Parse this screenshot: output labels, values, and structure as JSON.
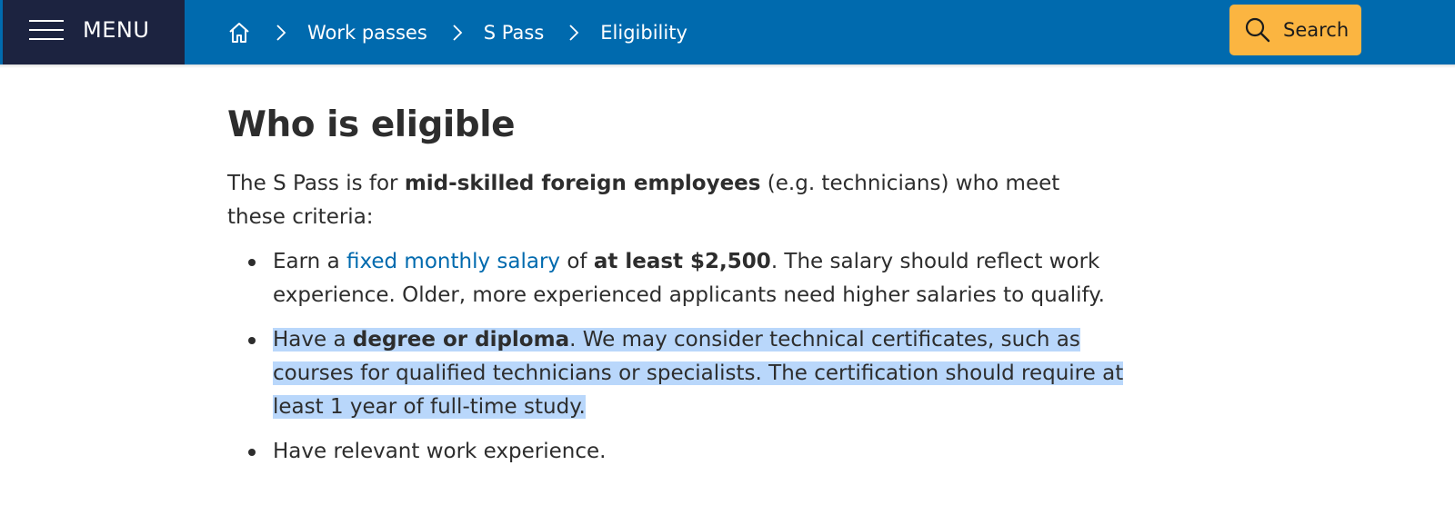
{
  "header": {
    "menu_label": "MENU",
    "breadcrumbs": [
      "Work passes",
      "S Pass",
      "Eligibility"
    ],
    "search_label": "Search"
  },
  "main": {
    "title": "Who is eligible",
    "intro": {
      "pre": "The S Pass is for ",
      "bold": "mid-skilled foreign employees",
      "post": " (e.g. technicians) who meet these criteria:"
    },
    "criteria": [
      {
        "pre": "Earn a ",
        "link": "fixed monthly salary",
        "mid": " of ",
        "bold": "at least $2,500",
        "post": ". The salary should reflect work experience. Older, more experienced applicants need higher salaries to qualify."
      },
      {
        "pre": "Have a ",
        "bold": "degree or diploma",
        "post": ". We may consider technical certificates, such as courses for qualified technicians or specialists. The certification should require at least 1 year of full-time study.",
        "highlighted": true
      },
      {
        "text": "Have relevant work experience."
      }
    ]
  },
  "colors": {
    "header_bg": "#006aae",
    "menu_bg": "#1c2340",
    "search_bg": "#fbb541",
    "link": "#006aae",
    "selection": "#b9d7fb"
  },
  "icons": [
    "hamburger-icon",
    "home-icon",
    "chevron-right-icon",
    "search-icon"
  ]
}
